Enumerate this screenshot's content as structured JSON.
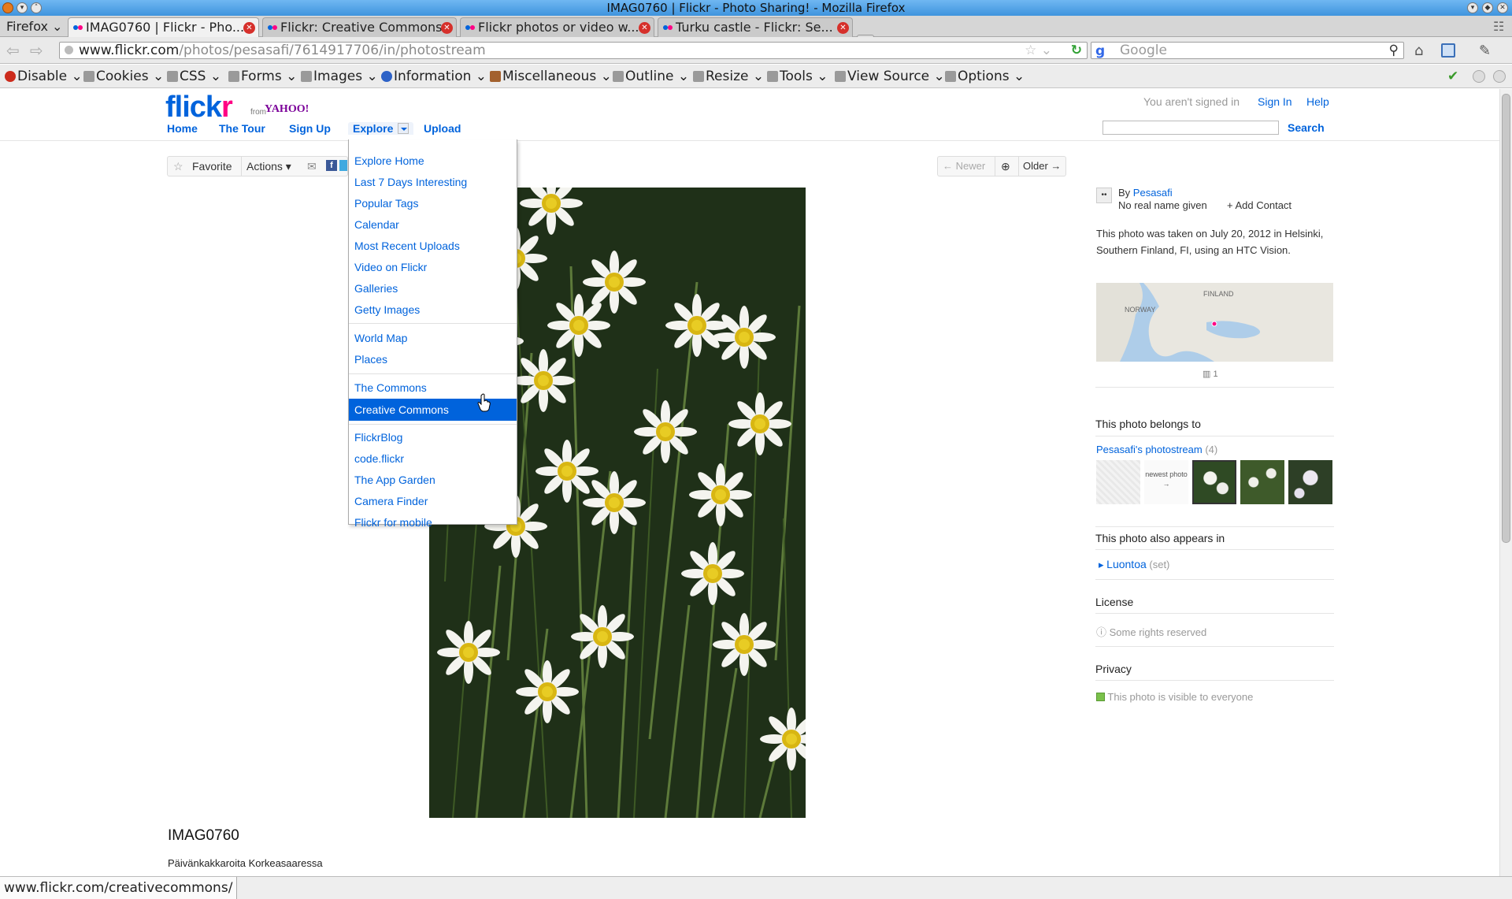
{
  "browser": {
    "window_title": "IMAG0760 | Flickr - Photo Sharing! - Mozilla Firefox",
    "firefox_menu": "Firefox",
    "tabs": [
      {
        "label": "IMAG0760 | Flickr - Pho...",
        "active": true
      },
      {
        "label": "Flickr: Creative Commons",
        "active": false
      },
      {
        "label": "Flickr photos or video w...",
        "active": false
      },
      {
        "label": "Turku castle - Flickr: Se...",
        "active": false
      }
    ],
    "url_host": "www.flickr.com",
    "url_path": "/photos/pesasafi/7614917706/in/photostream",
    "search_placeholder": "Google",
    "status_url": "www.flickr.com/creativecommons/"
  },
  "devtoolbar": {
    "items": [
      "Disable",
      "Cookies",
      "CSS",
      "Forms",
      "Images",
      "Information",
      "Miscellaneous",
      "Outline",
      "Resize",
      "Tools",
      "View Source",
      "Options"
    ]
  },
  "flickr": {
    "logo_main": "flickr",
    "logo_from": "from",
    "logo_yahoo": "YAHOO!",
    "nav": {
      "home": "Home",
      "tour": "The Tour",
      "signup": "Sign Up",
      "explore": "Explore",
      "upload": "Upload"
    },
    "top_right": {
      "not_signed": "You aren't signed in",
      "signin": "Sign In",
      "help": "Help",
      "search_btn": "Search"
    },
    "toolbar": {
      "favorite": "Favorite",
      "actions": "Actions"
    },
    "pager": {
      "newer": "← Newer",
      "older": "Older →"
    },
    "explore_menu": [
      "Explore Home",
      "Last 7 Days Interesting",
      "Popular Tags",
      "Calendar",
      "Most Recent Uploads",
      "Video on Flickr",
      "Galleries",
      "Getty Images",
      "World Map",
      "Places",
      "The Commons",
      "Creative Commons",
      "FlickrBlog",
      "code.flickr",
      "The App Garden",
      "Camera Finder",
      "Flickr for mobile"
    ],
    "photo_title": "IMAG0760",
    "photo_description": "Päivänkakkaroita Korkeasaaressa",
    "sidebar": {
      "by": "By",
      "owner": "Pesasafi",
      "real_name": "No real name given",
      "add_contact": "+ Add Contact",
      "taken_text": "This photo was taken on July 20, 2012 in Helsinki, Southern Finland, FI, using an HTC Vision.",
      "map_labels": [
        "FINLAND",
        "NORWAY"
      ],
      "views_count": "1",
      "belongs_title": "This photo belongs to",
      "photostream": "Pesasafi's photostream",
      "photostream_count": "(4)",
      "newest_label": "newest photo →",
      "appears_title": "This photo also appears in",
      "set_name": "Luontoa",
      "set_label": "(set)",
      "license_title": "License",
      "license_text": "Some rights reserved",
      "privacy_title": "Privacy",
      "privacy_text": "This photo is visible to everyone"
    }
  },
  "colors": {
    "flickr_blue": "#0063dc",
    "flickr_pink": "#ff0084",
    "yahoo_purple": "#7b0099",
    "menu_highlight": "#0063dc"
  }
}
